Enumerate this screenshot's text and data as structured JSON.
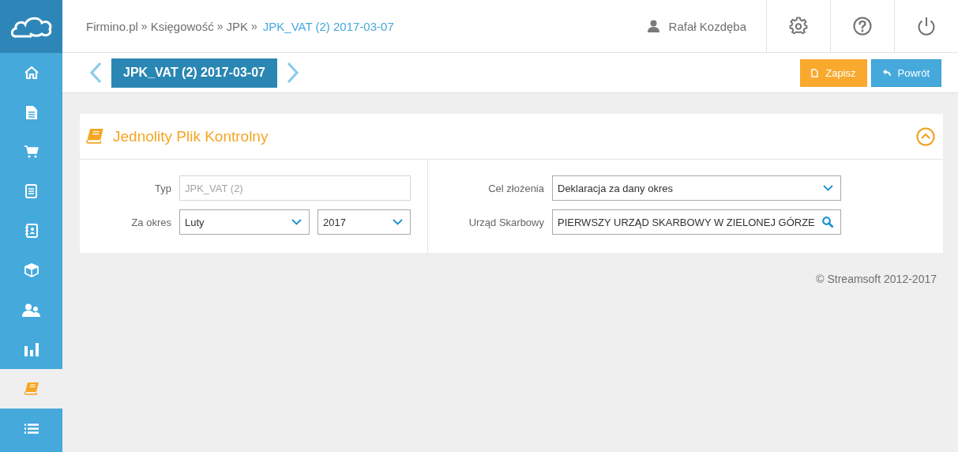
{
  "sidebar": {
    "items": [
      {
        "kind": "home",
        "selected": false
      },
      {
        "kind": "document",
        "selected": false
      },
      {
        "kind": "cart",
        "selected": false
      },
      {
        "kind": "clipboard",
        "selected": false
      },
      {
        "kind": "contacts",
        "selected": false
      },
      {
        "kind": "box",
        "selected": false
      },
      {
        "kind": "users",
        "selected": false
      },
      {
        "kind": "chart",
        "selected": false
      },
      {
        "kind": "book",
        "selected": true
      },
      {
        "kind": "list",
        "selected": false
      }
    ]
  },
  "breadcrumb": {
    "separator": "»",
    "items": [
      {
        "label": "Firmino.pl",
        "current": false
      },
      {
        "label": "Księgowość",
        "current": false
      },
      {
        "label": "JPK",
        "current": false
      },
      {
        "label": "JPK_VAT (2) 2017-03-07",
        "current": true
      }
    ]
  },
  "user": {
    "name": "Rafał Kozdęba"
  },
  "toolbar": {
    "title": "JPK_VAT (2) 2017-03-07",
    "buttons": [
      {
        "kind": "save",
        "label": "Zapisz"
      },
      {
        "kind": "back",
        "label": "Powrót"
      }
    ]
  },
  "panel": {
    "title": "Jednolity Plik Kontrolny",
    "expanded": true,
    "left": [
      {
        "label": "Typ",
        "fields": [
          {
            "kind": "text",
            "value": "JPK_VAT (2)",
            "disabled": true
          }
        ]
      },
      {
        "label": "Za okres",
        "fields": [
          {
            "kind": "select",
            "value": "Luty"
          },
          {
            "kind": "select",
            "value": "2017"
          }
        ]
      }
    ],
    "right": [
      {
        "label": "Cel złożenia",
        "fields": [
          {
            "kind": "select",
            "value": "Deklaracja za dany okres"
          }
        ]
      },
      {
        "label": "Urząd Skarbowy",
        "fields": [
          {
            "kind": "search",
            "value": "PIERWSZY URZĄD SKARBOWY W ZIELONEJ GÓRZE"
          }
        ]
      }
    ]
  },
  "footer": "© Streamsoft 2012-2017"
}
